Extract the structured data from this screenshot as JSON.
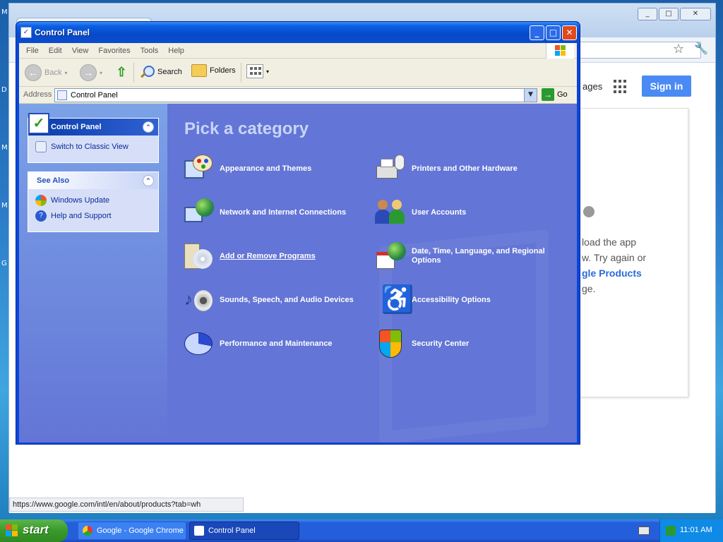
{
  "desktop": {
    "letters": [
      "M",
      "D",
      "M",
      "M",
      "G"
    ]
  },
  "chrome": {
    "images_link": "ages",
    "sign_in": "Sign in",
    "message_lines": [
      "load the app",
      "w. Try again or",
      "gle Products",
      "ge."
    ],
    "status_url": "https://www.google.com/intl/en/about/products?tab=wh",
    "window_controls": [
      "_",
      "□",
      "✕"
    ]
  },
  "control_panel": {
    "title": "Control Panel",
    "menu": [
      "File",
      "Edit",
      "View",
      "Favorites",
      "Tools",
      "Help"
    ],
    "toolbar": {
      "back": "Back",
      "search": "Search",
      "folders": "Folders"
    },
    "address": {
      "label": "Address",
      "value": "Control Panel",
      "go": "Go"
    },
    "task_pane": {
      "control_panel_header": "Control Panel",
      "switch_link": "Switch to Classic View",
      "see_also_header": "See Also",
      "see_also_links": [
        "Windows Update",
        "Help and Support"
      ]
    },
    "heading": "Pick a category",
    "categories": {
      "appearance": "Appearance and Themes",
      "printers": "Printers and Other Hardware",
      "network": "Network and Internet Connections",
      "accounts": "User Accounts",
      "add_remove": "Add or Remove Programs",
      "date_time_1": "Date, Time, Language, and Regional",
      "date_time_2": "Options",
      "sounds": "Sounds, Speech, and Audio Devices",
      "accessibility": "Accessibility Options",
      "performance": "Performance and Maintenance",
      "security": "Security Center"
    }
  },
  "taskbar": {
    "start": "start",
    "tasks": [
      "Google - Google Chrome",
      "Control Panel"
    ],
    "clock": "11:01 AM"
  },
  "colors": {
    "taskbar": "#245edb",
    "category_bg": "#6375d6",
    "start": "#3a9a2a"
  }
}
